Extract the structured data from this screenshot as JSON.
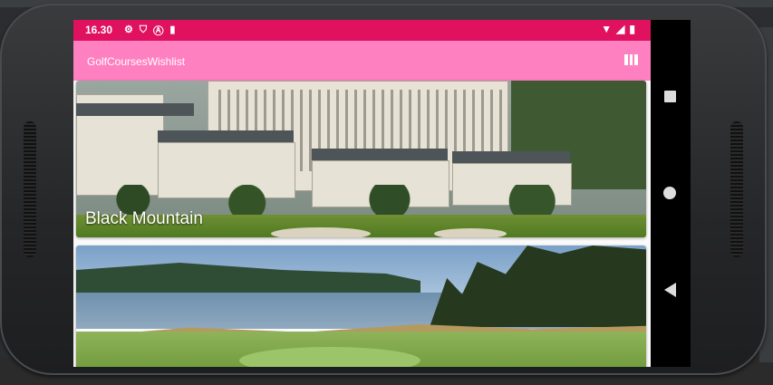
{
  "status_bar": {
    "time": "16.30",
    "left_icons": [
      "gear-icon",
      "shield-icon",
      "a-icon",
      "sd-card-icon"
    ],
    "right_icons": [
      "wifi-icon",
      "signal-icon",
      "battery-icon"
    ]
  },
  "app_bar": {
    "title": "GolfCoursesWishlist",
    "action_icon": "grid-icon"
  },
  "cards": [
    {
      "title": "Black Mountain"
    },
    {
      "title": ""
    }
  ],
  "nav_bar": {
    "icons": [
      "recent-apps-icon",
      "home-icon",
      "back-icon"
    ]
  },
  "colors": {
    "status_bar": "#e0115f",
    "app_bar": "#ff80c0"
  }
}
